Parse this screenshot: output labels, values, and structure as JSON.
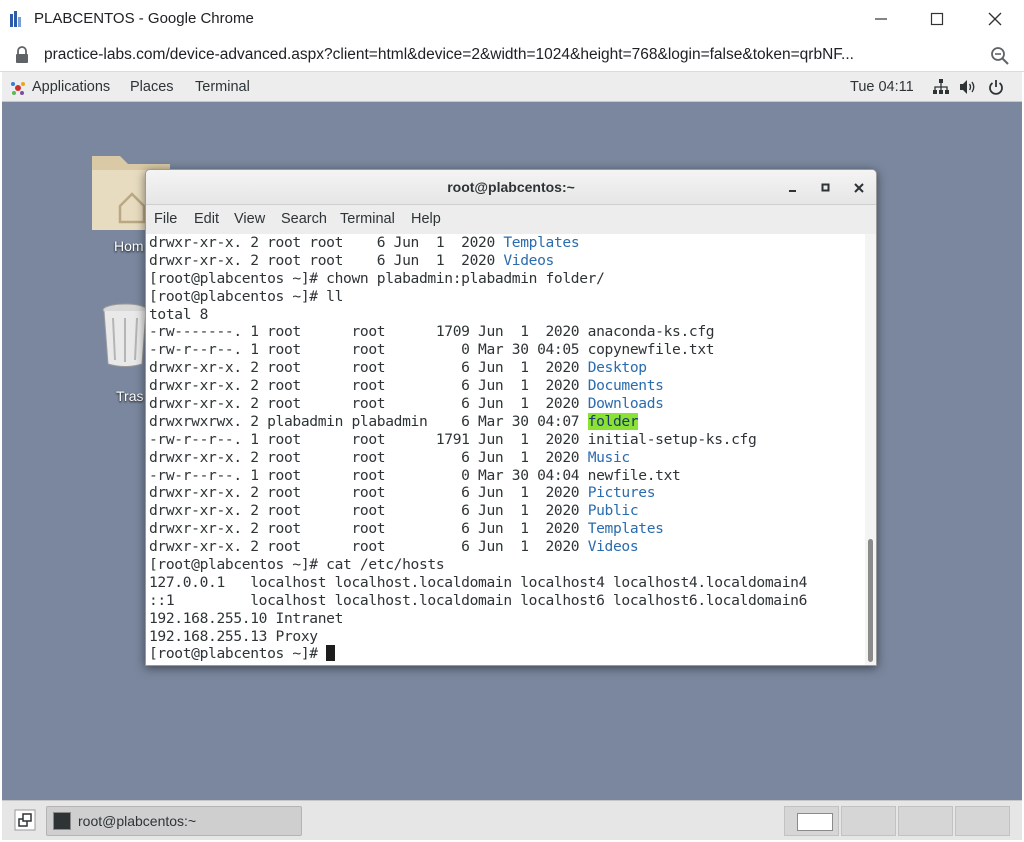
{
  "browser": {
    "title": "PLABCENTOS - Google Chrome",
    "url": "practice-labs.com/device-advanced.aspx?client=html&device=2&width=1024&height=768&login=false&token=qrbNF..."
  },
  "topbar": {
    "applications": "Applications",
    "places": "Places",
    "terminal": "Terminal",
    "clock": "Tue 04:11"
  },
  "desktop_icons": {
    "home": "Hom",
    "trash": "Tras"
  },
  "terminal": {
    "title": "root@plabcentos:~",
    "menu": [
      "File",
      "Edit",
      "View",
      "Search",
      "Terminal",
      "Help"
    ],
    "lines": [
      {
        "text": "drwxr-xr-x. 2 root root    6 Jun  1  2020 ",
        "name": "Templates"
      },
      {
        "text": "drwxr-xr-x. 2 root root    6 Jun  1  2020 ",
        "name": "Videos"
      },
      {
        "text": "[root@plabcentos ~]# chown plabadmin:plabadmin folder/"
      },
      {
        "text": "[root@plabcentos ~]# ll"
      },
      {
        "text": "total 8"
      },
      {
        "text": "-rw-------. 1 root      root      1709 Jun  1  2020 anaconda-ks.cfg"
      },
      {
        "text": "-rw-r--r--. 1 root      root         0 Mar 30 04:05 copynewfile.txt"
      },
      {
        "text": "drwxr-xr-x. 2 root      root         6 Jun  1  2020 ",
        "name": "Desktop"
      },
      {
        "text": "drwxr-xr-x. 2 root      root         6 Jun  1  2020 ",
        "name": "Documents"
      },
      {
        "text": "drwxr-xr-x. 2 root      root         6 Jun  1  2020 ",
        "name": "Downloads"
      },
      {
        "text": "drwxrwxrwx. 2 plabadmin plabadmin    6 Mar 30 04:07 ",
        "name": "folder",
        "highlight": true
      },
      {
        "text": "-rw-r--r--. 1 root      root      1791 Jun  1  2020 initial-setup-ks.cfg"
      },
      {
        "text": "drwxr-xr-x. 2 root      root         6 Jun  1  2020 ",
        "name": "Music"
      },
      {
        "text": "-rw-r--r--. 1 root      root         0 Mar 30 04:04 newfile.txt"
      },
      {
        "text": "drwxr-xr-x. 2 root      root         6 Jun  1  2020 ",
        "name": "Pictures"
      },
      {
        "text": "drwxr-xr-x. 2 root      root         6 Jun  1  2020 ",
        "name": "Public"
      },
      {
        "text": "drwxr-xr-x. 2 root      root         6 Jun  1  2020 ",
        "name": "Templates"
      },
      {
        "text": "drwxr-xr-x. 2 root      root         6 Jun  1  2020 ",
        "name": "Videos"
      },
      {
        "text": "[root@plabcentos ~]# cat /etc/hosts"
      },
      {
        "text": "127.0.0.1   localhost localhost.localdomain localhost4 localhost4.localdomain4"
      },
      {
        "text": "::1         localhost localhost.localdomain localhost6 localhost6.localdomain6"
      },
      {
        "text": "192.168.255.10 Intranet"
      },
      {
        "text": "192.168.255.13 Proxy"
      },
      {
        "text": "[root@plabcentos ~]# ",
        "cursor": true
      }
    ]
  },
  "taskbar": {
    "task_label": "root@plabcentos:~"
  },
  "colors": {
    "desktop_bg": "#7a879e",
    "dir_blue": "#2a6cae",
    "highlight_green": "#8ae234"
  }
}
